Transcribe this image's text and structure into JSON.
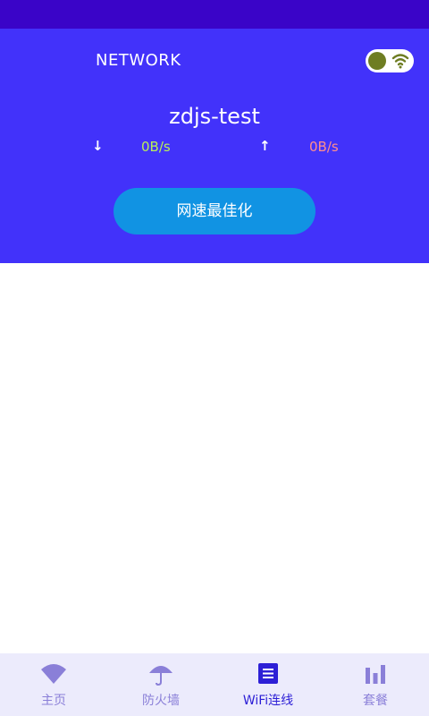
{
  "header": {
    "section_label": "NETWORK",
    "network_name": "zdjs-test",
    "download_arrow": "↓",
    "download_speed": "0B/s",
    "upload_arrow": "↑",
    "upload_speed": "0B/s",
    "optimize_button_label": "网速最佳化",
    "toggle_on": true
  },
  "bottom_nav": {
    "items": [
      {
        "label": "主页",
        "icon": "wifi-icon",
        "active": false
      },
      {
        "label": "防火墙",
        "icon": "umbrella-icon",
        "active": false
      },
      {
        "label": "WiFi连线",
        "icon": "list-icon",
        "active": true
      },
      {
        "label": "套餐",
        "icon": "bar-chart-icon",
        "active": false
      }
    ]
  },
  "colors": {
    "status_bar": "#3a04c8",
    "header_bg": "#4232fa",
    "button_bg": "#1193e3",
    "download_speed": "#b8f05a",
    "upload_speed": "#ff8e8e",
    "nav_bg": "#ecebfc",
    "nav_inactive": "#8a7fd8",
    "nav_active": "#2d1fd6"
  }
}
